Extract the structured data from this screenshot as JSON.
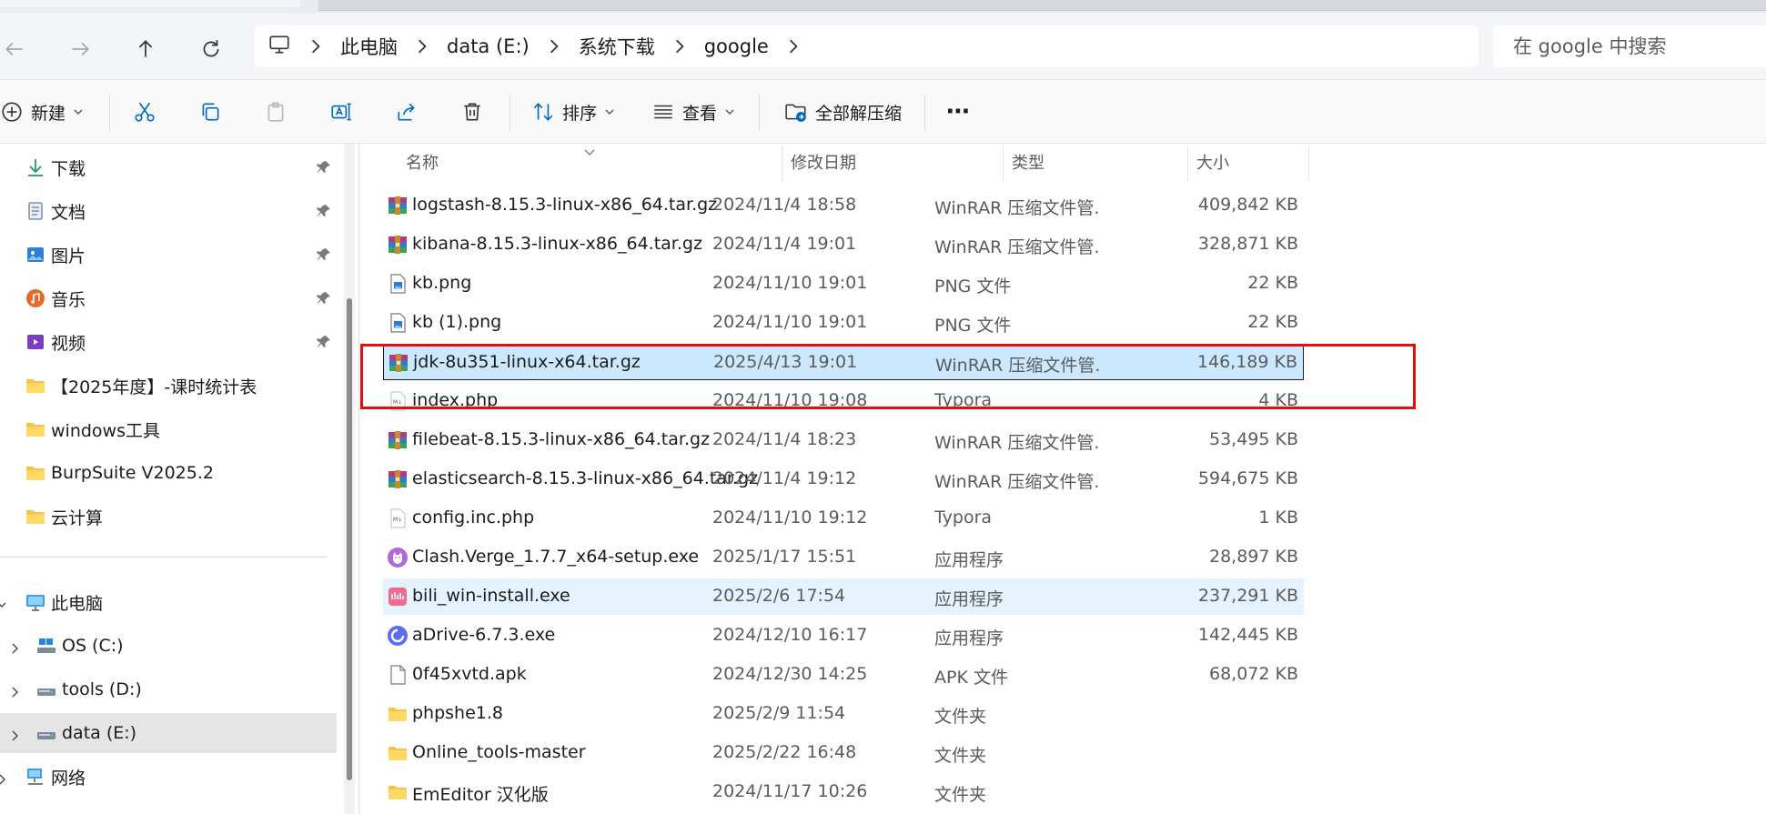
{
  "window": {
    "colors": {
      "accent": "#0067c0",
      "selection": "#cce8ff",
      "hover": "#e5f3ff",
      "annotation": "#e01010"
    }
  },
  "address": {
    "crumbs": [
      "此电脑",
      "data (E:)",
      "系统下载",
      "google"
    ],
    "search_placeholder": "在 google 中搜索"
  },
  "toolbar": {
    "new_label": "新建",
    "sort_label": "排序",
    "view_label": "查看",
    "extract_label": "全部解压缩",
    "more_label": "⋯"
  },
  "sidebar": {
    "quick": [
      {
        "label": "下载",
        "icon": "download-icon"
      },
      {
        "label": "文档",
        "icon": "document-icon"
      },
      {
        "label": "图片",
        "icon": "pictures-icon"
      },
      {
        "label": "音乐",
        "icon": "music-icon"
      },
      {
        "label": "视频",
        "icon": "video-icon"
      },
      {
        "label": "【2025年度】-课时统计表",
        "icon": "folder-icon"
      },
      {
        "label": "windows工具",
        "icon": "folder-icon"
      },
      {
        "label": "BurpSuite V2025.2",
        "icon": "folder-icon"
      },
      {
        "label": "云计算",
        "icon": "folder-icon"
      }
    ],
    "tree": [
      {
        "label": "此电脑",
        "icon": "computer-icon"
      },
      {
        "label": "OS (C:)",
        "icon": "drive-c-icon"
      },
      {
        "label": "tools (D:)",
        "icon": "drive-icon"
      },
      {
        "label": "data (E:)",
        "icon": "drive-icon"
      },
      {
        "label": "网络",
        "icon": "network-icon"
      }
    ]
  },
  "columns": {
    "name": "名称",
    "date": "修改日期",
    "type": "类型",
    "size": "大小"
  },
  "files": [
    {
      "name": "logstash-8.15.3-linux-x86_64.tar.gz",
      "date": "2024/11/4 18:58",
      "type": "WinRAR 压缩文件管...",
      "size": "409,842 KB",
      "icon": "winrar-archive-icon"
    },
    {
      "name": "kibana-8.15.3-linux-x86_64.tar.gz",
      "date": "2024/11/4 19:01",
      "type": "WinRAR 压缩文件管...",
      "size": "328,871 KB",
      "icon": "winrar-archive-icon"
    },
    {
      "name": "kb.png",
      "date": "2024/11/10 19:01",
      "type": "PNG 文件",
      "size": "22 KB",
      "icon": "png-file-icon"
    },
    {
      "name": "kb (1).png",
      "date": "2024/11/10 19:01",
      "type": "PNG 文件",
      "size": "22 KB",
      "icon": "png-file-icon"
    },
    {
      "name": "jdk-8u351-linux-x64.tar.gz",
      "date": "2025/4/13 19:01",
      "type": "WinRAR 压缩文件管...",
      "size": "146,189 KB",
      "icon": "winrar-archive-icon",
      "state": "selected"
    },
    {
      "name": "index.php",
      "date": "2024/11/10 19:08",
      "type": "Typora",
      "size": "4 KB",
      "icon": "typora-file-icon"
    },
    {
      "name": "filebeat-8.15.3-linux-x86_64.tar.gz",
      "date": "2024/11/4 18:23",
      "type": "WinRAR 压缩文件管...",
      "size": "53,495 KB",
      "icon": "winrar-archive-icon"
    },
    {
      "name": "elasticsearch-8.15.3-linux-x86_64.tar.gz",
      "date": "2024/11/4 19:12",
      "type": "WinRAR 压缩文件管...",
      "size": "594,675 KB",
      "icon": "winrar-archive-icon"
    },
    {
      "name": "config.inc.php",
      "date": "2024/11/10 19:12",
      "type": "Typora",
      "size": "1 KB",
      "icon": "typora-file-icon"
    },
    {
      "name": "Clash.Verge_1.7.7_x64-setup.exe",
      "date": "2025/1/17 15:51",
      "type": "应用程序",
      "size": "28,897 KB",
      "icon": "clash-app-icon"
    },
    {
      "name": "bili_win-install.exe",
      "date": "2025/2/6 17:54",
      "type": "应用程序",
      "size": "237,291 KB",
      "icon": "bilibili-app-icon",
      "state": "hover"
    },
    {
      "name": "aDrive-6.7.3.exe",
      "date": "2024/12/10 16:17",
      "type": "应用程序",
      "size": "142,445 KB",
      "icon": "adrive-app-icon"
    },
    {
      "name": "0f45xvtd.apk",
      "date": "2024/12/30 14:25",
      "type": "APK 文件",
      "size": "68,072 KB",
      "icon": "blank-file-icon"
    },
    {
      "name": "phpshe1.8",
      "date": "2025/2/9 11:54",
      "type": "文件夹",
      "size": "",
      "icon": "folder-icon"
    },
    {
      "name": "Online_tools-master",
      "date": "2025/2/22 16:48",
      "type": "文件夹",
      "size": "",
      "icon": "folder-icon"
    },
    {
      "name": "EmEditor 汉化版",
      "date": "2024/11/17 10:26",
      "type": "文件夹",
      "size": "",
      "icon": "folder-icon"
    }
  ]
}
